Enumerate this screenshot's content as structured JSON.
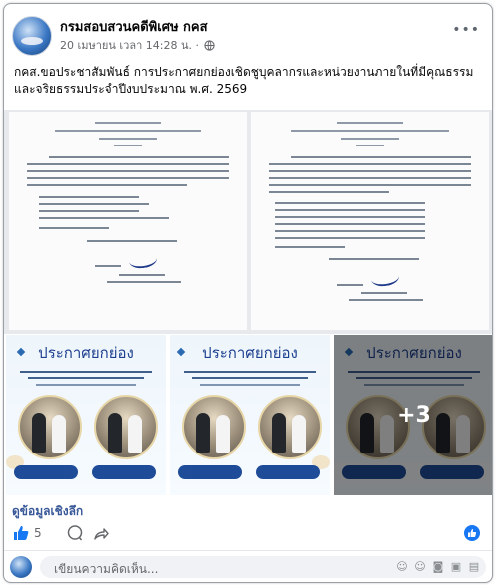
{
  "post": {
    "page_name": "กรมสอบสวนคดีพิเศษ กคส",
    "timestamp": "20 เมษายน เวลา 14:28 น. ·",
    "text": "กคส.ขอประชาสัมพันธ์ การประกาศยกย่องเชิดชูบุคลากรและหน่วยงานภายในที่มีคุณธรรมและจริยธรรมประจำปีงบประมาณ พ.ศ. 2569"
  },
  "photos": {
    "card_title": "ประกาศยกย่อง",
    "more_count": "+3"
  },
  "link_text": "ดูข้อมูลเชิงลึก",
  "reactions": {
    "like_count": "5"
  },
  "comment_box": {
    "placeholder": "เขียนความคิดเห็น..."
  },
  "icons": [
    "globe-icon",
    "more-icon",
    "like-icon",
    "comment-icon",
    "share-icon",
    "emoji-icon",
    "sticker-icon",
    "camera-icon",
    "gif-icon",
    "attach-icon"
  ],
  "colors": {
    "link": "#385898",
    "accent": "#1877f2",
    "title_blue": "#1d3f8f"
  }
}
